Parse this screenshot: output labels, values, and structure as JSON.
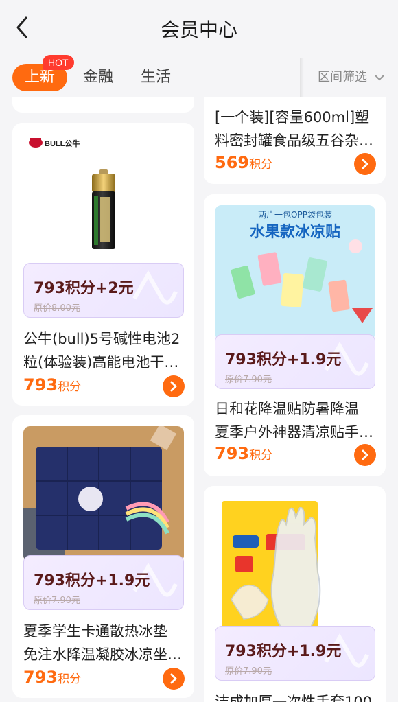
{
  "header": {
    "title": "会员中心"
  },
  "tabs": {
    "items": [
      {
        "label": "上新",
        "active": true,
        "badge": "HOT"
      },
      {
        "label": "金融"
      },
      {
        "label": "生活"
      }
    ],
    "filter_label": "区间筛选"
  },
  "colors": {
    "accent": "#ff6a10",
    "badge": "#ff3b2f",
    "price_box": "#f0e9ff"
  },
  "products": [
    {
      "brand_text": "BULL公牛",
      "price_combo": "793积分+2元",
      "original_price": "原价8.00元",
      "title_lines": [
        "公牛(bull)5号碱性电池2",
        "粒(体验装)高能电池干…"
      ],
      "points_num": "793",
      "points_unit": "积分"
    },
    {
      "title_lines": [
        "[一个装][容量600ml]塑",
        "料密封罐食品级五谷杂…"
      ],
      "points_num": "569",
      "points_unit": "积分"
    },
    {
      "banner_sub": "两片一包OPP袋包装",
      "banner_main": "水果款冰凉贴",
      "price_combo": "793积分+1.9元",
      "original_price": "原价7.90元",
      "title_lines": [
        "日和花降温贴防暑降温",
        "夏季户外神器清凉贴手…"
      ],
      "points_num": "793",
      "points_unit": "积分"
    },
    {
      "price_combo": "793积分+1.9元",
      "original_price": "原价7.90元",
      "title_lines": [
        "夏季学生卡通散热冰垫",
        "免注水降温凝胶冰凉坐…"
      ],
      "points_num": "793",
      "points_unit": "积分"
    },
    {
      "price_combo": "793积分+1.9元",
      "original_price": "原价7.90元",
      "title_lines": [
        "洁成加厚一次性手套100"
      ]
    }
  ]
}
